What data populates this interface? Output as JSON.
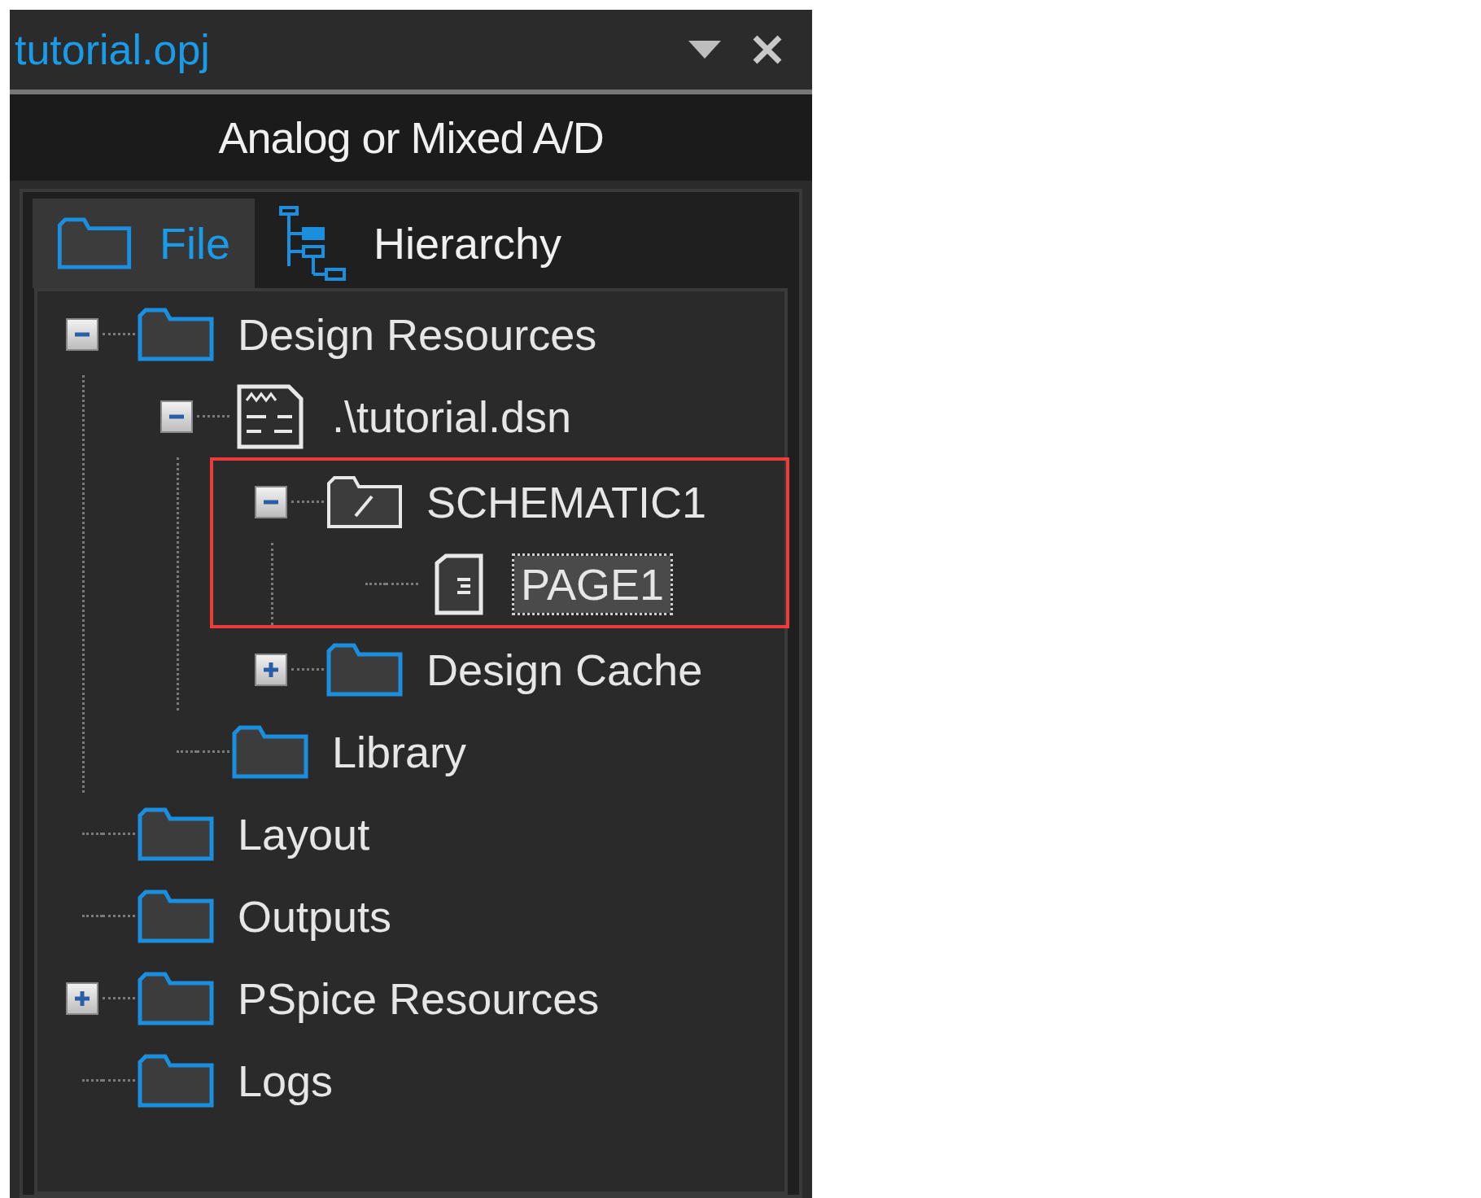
{
  "window": {
    "title": "tutorial.opj"
  },
  "header": {
    "title": "Analog or Mixed A/D"
  },
  "tabs": [
    {
      "label": "File",
      "kind": "file",
      "selected": true
    },
    {
      "label": "Hierarchy",
      "kind": "hierarchy",
      "selected": false
    }
  ],
  "tree": [
    {
      "label": "Design Resources",
      "kind": "folder",
      "expanded": true,
      "children": [
        {
          "label": ".\\tutorial.dsn",
          "kind": "design",
          "expanded": true,
          "children": [
            {
              "label": "SCHEMATIC1",
              "kind": "schematic",
              "expanded": true,
              "highlighted": true,
              "children": [
                {
                  "label": "PAGE1",
                  "kind": "page",
                  "selected": true
                }
              ]
            },
            {
              "label": "Design Cache",
              "kind": "folder",
              "expanded": false
            }
          ]
        },
        {
          "label": "Library",
          "kind": "folder"
        }
      ]
    },
    {
      "label": "Layout",
      "kind": "folder"
    },
    {
      "label": "Outputs",
      "kind": "folder"
    },
    {
      "label": "PSpice Resources",
      "kind": "folder",
      "expanded": false
    },
    {
      "label": "Logs",
      "kind": "folder"
    }
  ]
}
